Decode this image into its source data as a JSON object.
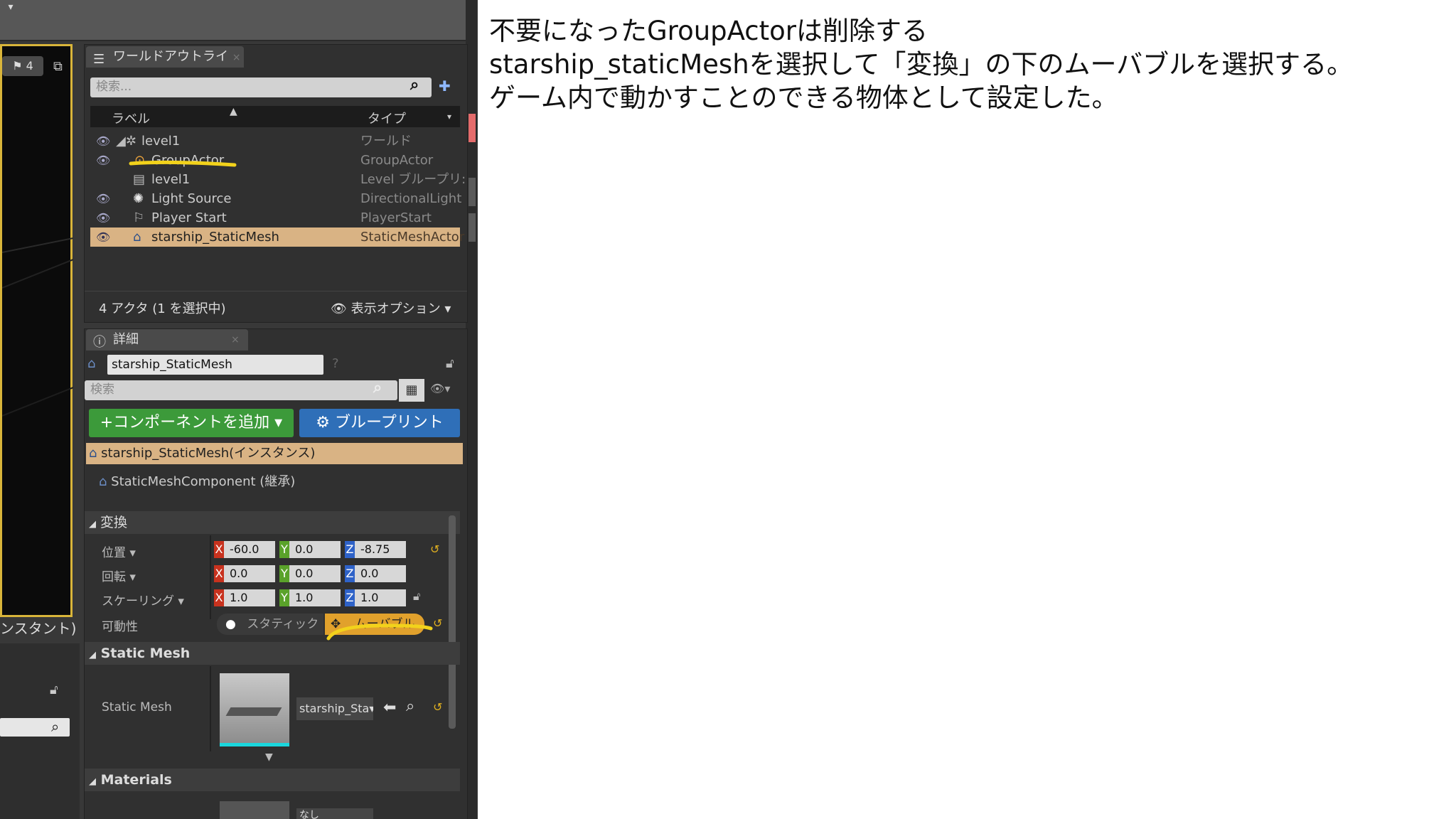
{
  "instructions": [
    "不要になったGroupActorは削除する",
    "starship_staticMeshを選択して「変換」の下のムーバブルを選択する。",
    "ゲーム内で動かすことのできる物体として設定した。"
  ],
  "viewport": {
    "badge": "4",
    "partial_label": "ンスタント)"
  },
  "outliner": {
    "tab_title": "ワールドアウトライ",
    "search_placeholder": "検索...",
    "columns": {
      "label": "ラベル",
      "type": "タイプ"
    },
    "rows": [
      {
        "label": "level1",
        "type": "ワールド"
      },
      {
        "label": "GroupActor",
        "type": "GroupActor"
      },
      {
        "label": "level1",
        "type": "Level ブループリ:"
      },
      {
        "label": "Light Source",
        "type": "DirectionalLight"
      },
      {
        "label": "Player Start",
        "type": "PlayerStart"
      },
      {
        "label": "starship_StaticMesh",
        "type": "StaticMeshActor"
      }
    ],
    "footer_count": "4 アクタ (1 を選択中)",
    "view_options": "表示オプション"
  },
  "details": {
    "tab_title": "詳細",
    "actor_name": "starship_StaticMesh",
    "search_placeholder": "検索",
    "add_component": "+コンポーネントを追加",
    "blueprint": "ブループリント",
    "components": [
      "starship_StaticMesh(インスタンス)",
      "StaticMeshComponent (継承)"
    ],
    "transform": {
      "header": "変換",
      "location_label": "位置",
      "rotation_label": "回転",
      "scale_label": "スケーリング",
      "mobility_label": "可動性",
      "location": {
        "x": "-60.0",
        "y": "0.0",
        "z": "-8.75"
      },
      "rotation": {
        "x": "0.0",
        "y": "0.0",
        "z": "0.0"
      },
      "scale": {
        "x": "1.0",
        "y": "1.0",
        "z": "1.0"
      },
      "static_option": "スタティック",
      "movable_option": "ムーバブル"
    },
    "static_mesh": {
      "header": "Static Mesh",
      "label": "Static Mesh",
      "asset": "starship_Sta"
    },
    "materials": {
      "header": "Materials",
      "asset_partial": "なし"
    }
  },
  "colors": {
    "highlight_yellow": "#f2d21b",
    "selected_row": "#d9b384",
    "add_button": "#3c9a3a",
    "blueprint_button": "#2f6fb8"
  }
}
